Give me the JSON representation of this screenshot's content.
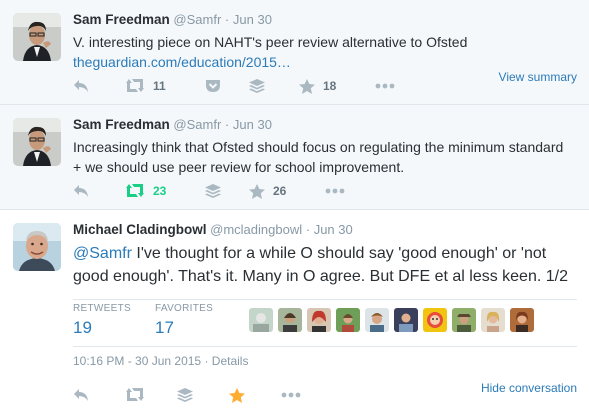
{
  "tweets": [
    {
      "fullname": "Sam Freedman",
      "username": "@Samfr",
      "time": "Jun 30",
      "text": "V. interesting piece on NAHT's peer review alternative to Ofsted",
      "link": "theguardian.com/education/2015…",
      "retweets": "11",
      "favorites": "18",
      "summary_link": "View summary"
    },
    {
      "fullname": "Sam Freedman",
      "username": "@Samfr",
      "time": "Jun 30",
      "text_line1": "Increasingly think that Ofsted should focus on regulating the minimum standard",
      "text_line2": "+ we should use peer review for school improvement.",
      "retweets": "23",
      "favorites": "26"
    },
    {
      "fullname": "Michael Cladingbowl",
      "username": "@mcladingbowl",
      "time": "Jun 30",
      "mention": "@Samfr",
      "text_line1": " I've thought for a while O should say 'good enough' or 'not",
      "text_line2": "good enough'. That's it. Many in O agree. But DFE et al less keen. 1/2",
      "retweets_label": "RETWEETS",
      "retweets": "19",
      "favorites_label": "FAVORITES",
      "favorites": "17",
      "timestamp": "10:16 PM - 30 Jun 2015",
      "details_link": "Details",
      "hide_link": "Hide conversation"
    }
  ],
  "separator": "·",
  "colors": {
    "link": "#2b7bb9",
    "retweet_active": "#19cf86",
    "favorite_active": "#ffac33",
    "icon_inactive": "#aab8c2"
  },
  "icons": [
    "reply-icon",
    "retweet-icon",
    "pocket-icon",
    "buffer-icon",
    "star-icon",
    "more-icon"
  ]
}
